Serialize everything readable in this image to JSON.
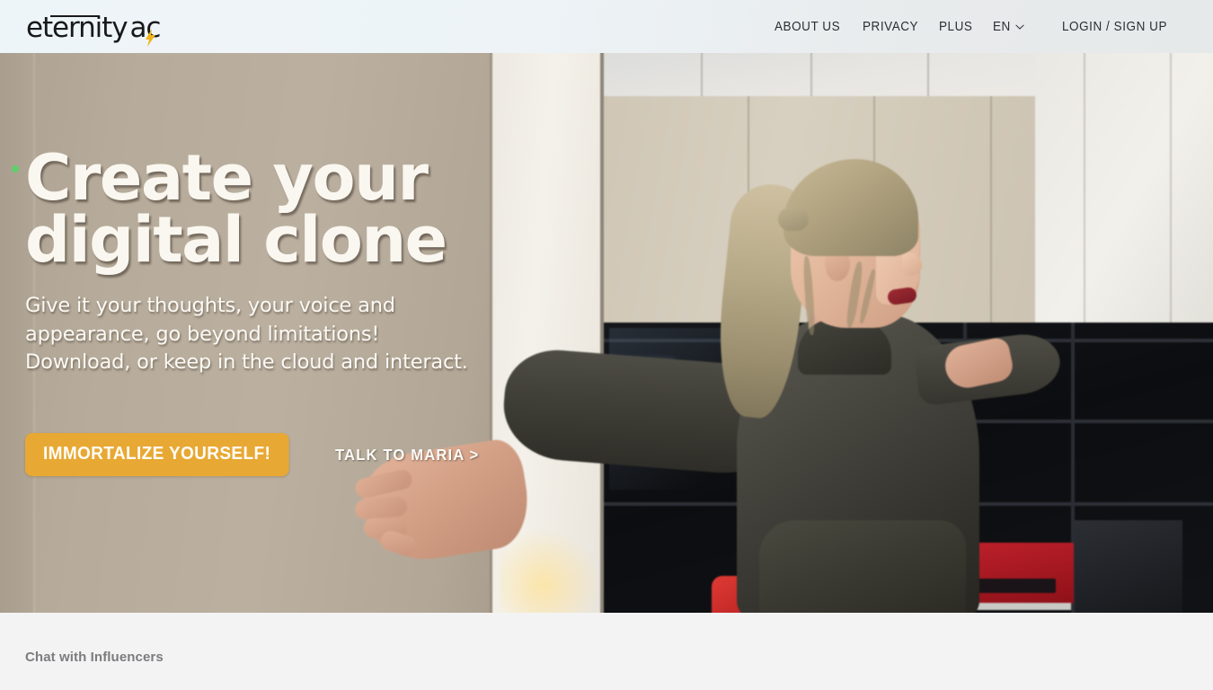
{
  "header": {
    "logo": {
      "name": "eternity",
      "suffix": "ac",
      "bolt_icon": "lightning-bolt-icon",
      "bolt_color": "#F2B41A"
    },
    "nav": [
      {
        "label": "ABOUT US",
        "name": "about-us"
      },
      {
        "label": "PRIVACY",
        "name": "privacy"
      },
      {
        "label": "PLUS",
        "name": "plus"
      }
    ],
    "language": {
      "label": "EN",
      "chevron_icon": "chevron-down-icon"
    },
    "auth": {
      "label": "LOGIN / SIGN UP"
    },
    "background_color": "#EDF4F8"
  },
  "hero": {
    "status_dot_color": "#5FCE6A",
    "headline_line1": "Create your",
    "headline_line2": "digital clone",
    "subhead": "Give it your thoughts, your voice and\nappearance, go beyond limitations!\nDownload, or keep in the cloud and interact.",
    "cta_primary": "IMMORTALIZE YOURSELF!",
    "cta_primary_color": "#E8A834",
    "cta_secondary": "TALK TO MARIA >",
    "media_description": "Video of a blonde woman in a dark turtleneck with arms outstretched in a modern interior"
  },
  "below": {
    "section_title": "Chat with Influencers",
    "background_color": "#F3F3F3"
  }
}
